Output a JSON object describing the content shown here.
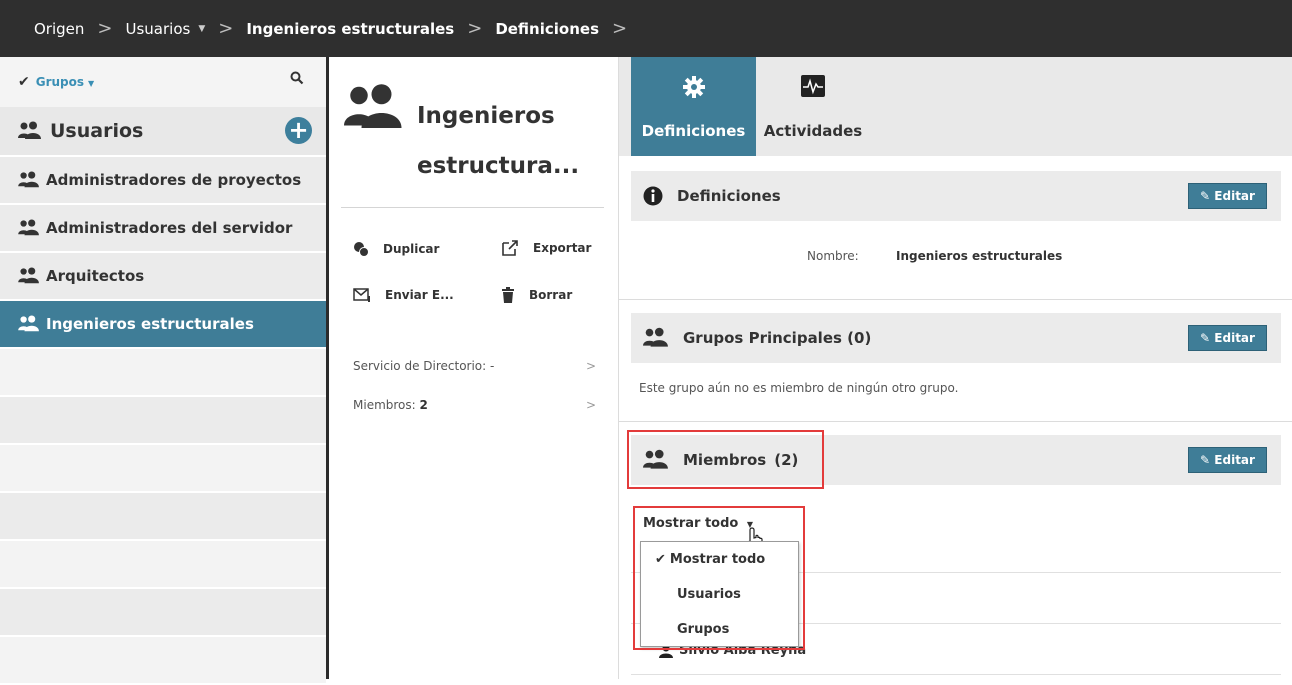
{
  "breadcrumb": {
    "items": [
      {
        "label": "Origen",
        "bold": false
      },
      {
        "label": "Usuarios",
        "bold": false,
        "dropdown": true
      },
      {
        "label": "Ingenieros estructurales",
        "bold": true
      },
      {
        "label": "Definiciones",
        "bold": true
      }
    ],
    "separator": ">"
  },
  "sidebar": {
    "groups_toggle": "Grupos",
    "title": "Usuarios",
    "items": [
      {
        "label": "Administradores de proyectos",
        "active": false
      },
      {
        "label": "Administradores del servidor",
        "active": false
      },
      {
        "label": "Arquitectos",
        "active": false
      },
      {
        "label": "Ingenieros estructurales",
        "active": true
      }
    ]
  },
  "middle": {
    "title_line1": "Ingenieros",
    "title_line2": "estructura...",
    "actions": {
      "duplicate": "Duplicar",
      "export": "Exportar",
      "send": "Enviar E...",
      "delete": "Borrar"
    },
    "directory_label": "Servicio de Directorio: -",
    "members_label": "Miembros:",
    "members_count": "2",
    "chevron": ">"
  },
  "tabs": {
    "settings": "Definiciones",
    "activities": "Actividades"
  },
  "sections": {
    "definitions": {
      "title": "Definiciones",
      "edit": "Editar",
      "name_label": "Nombre:",
      "name_value": "Ingenieros estructurales"
    },
    "parent_groups": {
      "title": "Grupos Principales (0)",
      "edit": "Editar",
      "message": "Este grupo aún no es miembro de ningún otro grupo."
    },
    "members": {
      "title": "Miembros",
      "count": "(2)",
      "edit": "Editar",
      "filter_label": "Mostrar todo",
      "filter_options": [
        "Mostrar todo",
        "Usuarios",
        "Grupos"
      ],
      "selected_option": "Mostrar todo",
      "partial_member_name": "Silvio Alba Reyna"
    }
  },
  "colors": {
    "accent": "#3f7d97",
    "topbar": "#2f2f2f",
    "highlight": "#e33b3b"
  }
}
